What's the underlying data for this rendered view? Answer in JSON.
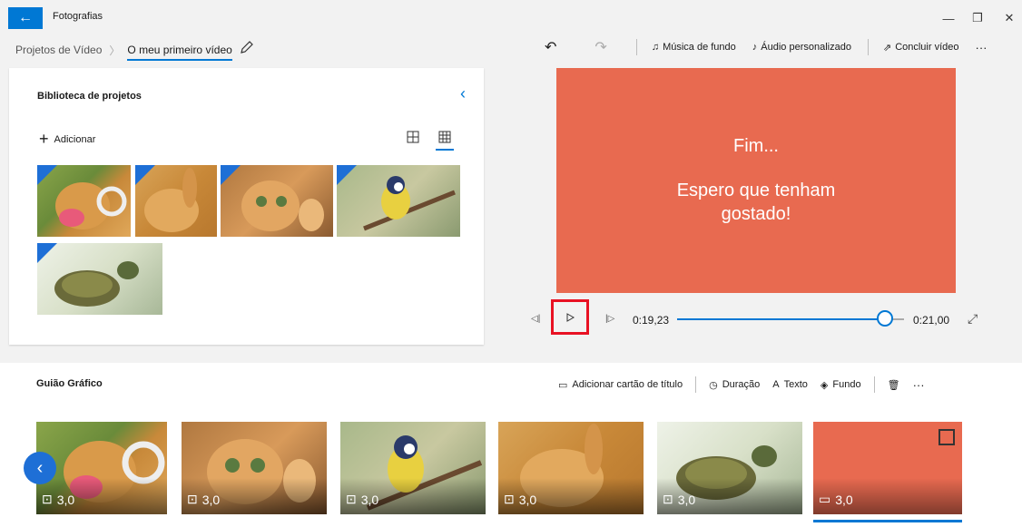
{
  "app": {
    "title": "Fotografias"
  },
  "breadcrumb": {
    "root": "Projetos de Vídeo",
    "current": "O meu primeiro vídeo"
  },
  "toolbar": {
    "undo_icon": "undo-icon",
    "redo_icon": "redo-icon",
    "music": "Música de fundo",
    "audio": "Áudio personalizado",
    "finish": "Concluir vídeo",
    "more": "···"
  },
  "library": {
    "title": "Biblioteca de projetos",
    "add": "Adicionar"
  },
  "preview": {
    "line1": "Fim...",
    "line2a": "Espero que tenham",
    "line2b": "gostado!",
    "background": "#e86a50"
  },
  "playback": {
    "current_time": "0:19,23",
    "total_time": "0:21,00",
    "progress": 0.915
  },
  "storyboard": {
    "title": "Guião Gráfico",
    "add_title_card": "Adicionar cartão de título",
    "duration": "Duração",
    "text": "Texto",
    "background": "Fundo",
    "more": "···",
    "clips": [
      {
        "subject": "dog",
        "duration": "3,0"
      },
      {
        "subject": "cat",
        "duration": "3,0"
      },
      {
        "subject": "bird",
        "duration": "3,0"
      },
      {
        "subject": "rabbit",
        "duration": "3,0"
      },
      {
        "subject": "turtle",
        "duration": "3,0"
      },
      {
        "subject": "title-card",
        "duration": "3,0"
      }
    ]
  },
  "colors": {
    "accent": "#0078d4",
    "highlight": "#e81123",
    "card": "#e86a50"
  }
}
